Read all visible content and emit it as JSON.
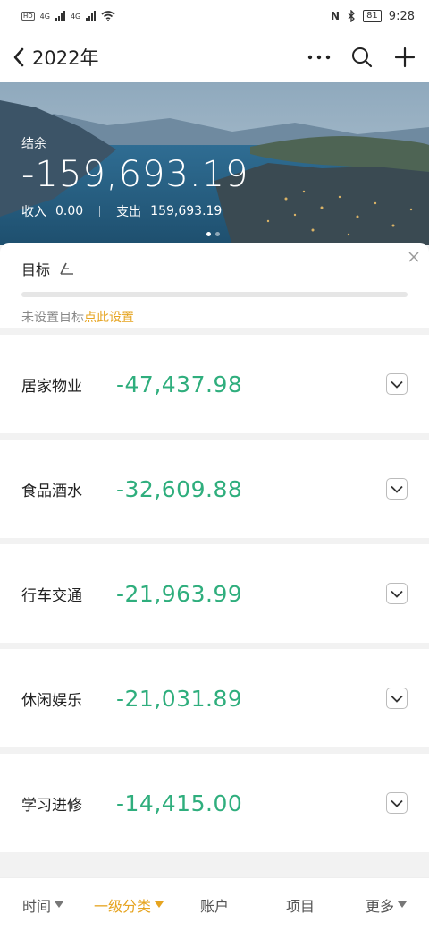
{
  "status_bar": {
    "hd1": "HD",
    "hd2": "HD",
    "net1": "4G",
    "net2": "4G",
    "nfc": "N",
    "battery": "81",
    "time": "9:28"
  },
  "header": {
    "title": "2022年",
    "icons": [
      "back-icon",
      "more-icon",
      "search-icon",
      "add-icon"
    ]
  },
  "hero": {
    "balance_label": "结余",
    "balance": "-159,693.19",
    "income_label": "收入",
    "income": "0.00",
    "expense_label": "支出",
    "expense": "159,693.19"
  },
  "goal": {
    "title": "目标",
    "hint": "未设置目标",
    "hint_link": "点此设置"
  },
  "categories": [
    {
      "name": "居家物业",
      "amount": "-47,437.98"
    },
    {
      "name": "食品酒水",
      "amount": "-32,609.88"
    },
    {
      "name": "行车交通",
      "amount": "-21,963.99"
    },
    {
      "name": "休闲娱乐",
      "amount": "-21,031.89"
    },
    {
      "name": "学习进修",
      "amount": "-14,415.00"
    }
  ],
  "tabs": [
    {
      "label": "时间",
      "active": false
    },
    {
      "label": "一级分类",
      "active": true
    },
    {
      "label": "账户",
      "active": false
    },
    {
      "label": "项目",
      "active": false
    },
    {
      "label": "更多",
      "active": false
    }
  ],
  "colors": {
    "accent": "#e6a420",
    "amount": "#2fae7d"
  }
}
